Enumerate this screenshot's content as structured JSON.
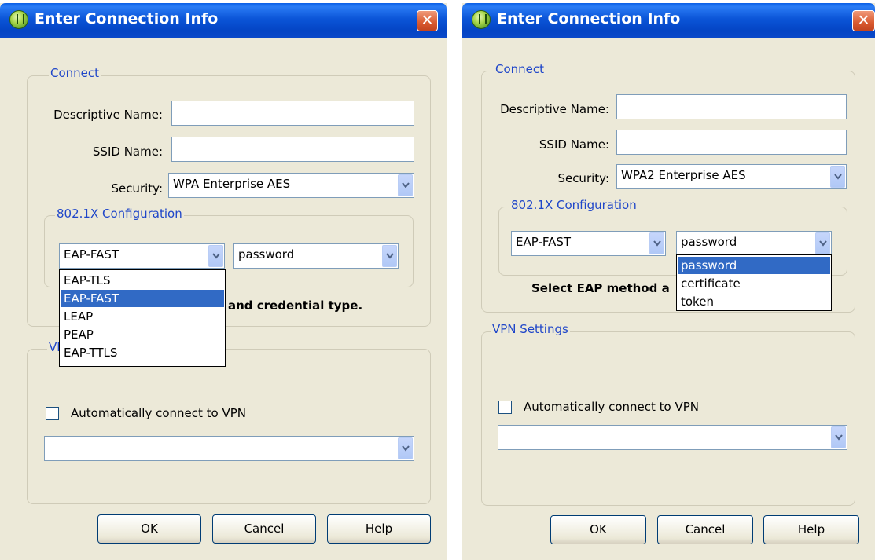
{
  "left_dialog": {
    "title": "Enter Connection Info",
    "close_glyph": "✕",
    "connect_legend": "Connect",
    "descriptive_name_label": "Descriptive Name:",
    "ssid_name_label": "SSID Name:",
    "security_label": "Security:",
    "security_value": "WPA Enterprise AES",
    "dot1x_legend": "802.1X Configuration",
    "eap_method_value": "EAP-FAST",
    "credential_value": "password",
    "eap_options": [
      "EAP-TLS",
      "EAP-FAST",
      "LEAP",
      "PEAP",
      "EAP-TTLS"
    ],
    "eap_selected_option": "EAP-FAST",
    "hint_visible": "and credential type.",
    "vpn_legend_visible": "VPN",
    "auto_vpn_label": "Automatically connect to VPN",
    "ok_label": "OK",
    "cancel_label": "Cancel",
    "help_label": "Help"
  },
  "right_dialog": {
    "title": "Enter Connection Info",
    "close_glyph": "✕",
    "connect_legend": "Connect",
    "descriptive_name_label": "Descriptive Name:",
    "ssid_name_label": "SSID Name:",
    "security_label": "Security:",
    "security_value": "WPA2 Enterprise AES",
    "dot1x_legend": "802.1X Configuration",
    "eap_method_value": "EAP-FAST",
    "credential_value": "password",
    "credential_options": [
      "password",
      "certificate",
      "token"
    ],
    "credential_selected_option": "password",
    "hint_visible": "Select EAP method a",
    "vpn_legend": "VPN Settings",
    "auto_vpn_label": "Automatically connect to VPN",
    "ok_label": "OK",
    "cancel_label": "Cancel",
    "help_label": "Help"
  },
  "icons": {
    "app_icon": "connection-globe-icon",
    "close_icon": "close-icon",
    "dropdown_arrow": "chevron-down-icon"
  },
  "colors": {
    "titlebar": "#0b55d8",
    "dialog_bg": "#ece9d8",
    "legend_text": "#1f46c9",
    "selection": "#316ac5",
    "close_button": "#d95a30"
  }
}
